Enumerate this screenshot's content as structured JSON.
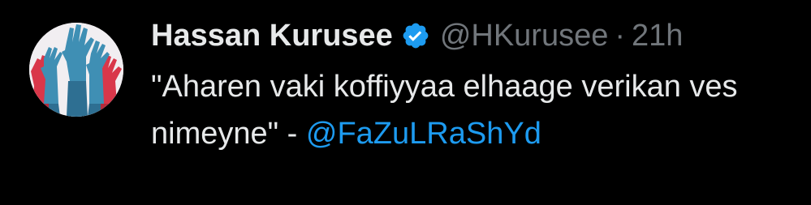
{
  "tweet": {
    "author": {
      "display_name": "Hassan Kurusee",
      "handle": "@HKurusee",
      "verified_icon": "verified-badge-icon",
      "verified_color": "#1d9bf0"
    },
    "separator": "·",
    "time": "21h",
    "text_before_mention": "\"Aharen vaki koffiyyaa elhaage verikan ves nimeyne\" - ",
    "mention": "@FaZuLRaShYd"
  },
  "colors": {
    "background": "#000000",
    "primary_text": "#e7e9ea",
    "secondary_text": "#71767b",
    "link": "#1d9bf0"
  }
}
